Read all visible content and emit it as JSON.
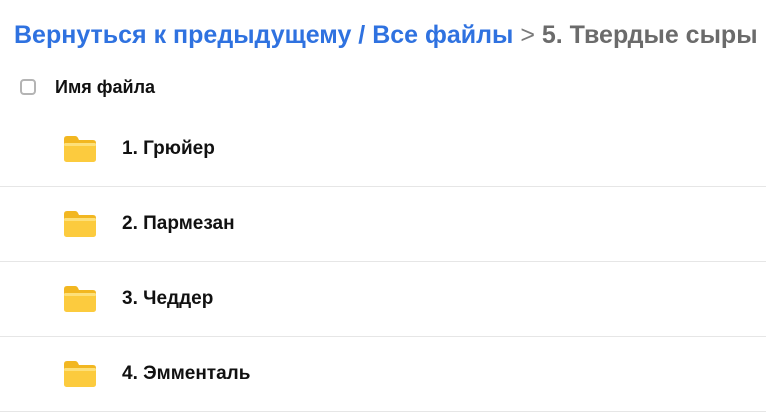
{
  "breadcrumb": {
    "back_label": "Вернуться к предыдущему",
    "separator_1": " / ",
    "all_files_label": "Все файлы",
    "separator_2": " > ",
    "current_label": "5. Твердые сыры"
  },
  "file_list": {
    "header_label": "Имя файла",
    "items": [
      {
        "label": "1. Грюйер",
        "icon": "folder-icon"
      },
      {
        "label": "2. Пармезан",
        "icon": "folder-icon"
      },
      {
        "label": "3. Чеддер",
        "icon": "folder-icon"
      },
      {
        "label": "4. Эмменталь",
        "icon": "folder-icon"
      }
    ]
  },
  "colors": {
    "link": "#2f72e0",
    "current_crumb": "#6b6b6b",
    "folder": "#f9c933",
    "divider": "#e6e6e6"
  }
}
